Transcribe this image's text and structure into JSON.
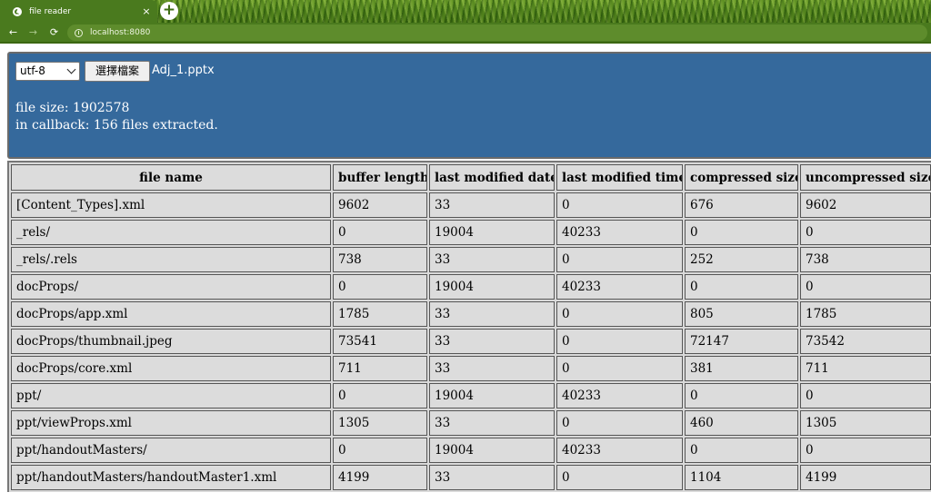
{
  "browser": {
    "tab_title": "file reader",
    "tab_close": "×",
    "new_tab": "+",
    "back": "←",
    "forward": "→",
    "reload": "⟳",
    "url": "localhost:8080"
  },
  "controls": {
    "encoding": "utf-8",
    "file_button": "選擇檔案",
    "file_name": "Adj_1.pptx"
  },
  "info": {
    "file_size": "file size: 1902578",
    "callback": "in callback: 156 files extracted."
  },
  "table": {
    "headers": [
      "file name",
      "buffer length",
      "last modified date",
      "last modified time",
      "compressed size",
      "uncompressed size"
    ],
    "rows": [
      [
        "[Content_Types].xml",
        "9602",
        "33",
        "0",
        "676",
        "9602"
      ],
      [
        "_rels/",
        "0",
        "19004",
        "40233",
        "0",
        "0"
      ],
      [
        "_rels/.rels",
        "738",
        "33",
        "0",
        "252",
        "738"
      ],
      [
        "docProps/",
        "0",
        "19004",
        "40233",
        "0",
        "0"
      ],
      [
        "docProps/app.xml",
        "1785",
        "33",
        "0",
        "805",
        "1785"
      ],
      [
        "docProps/thumbnail.jpeg",
        "73541",
        "33",
        "0",
        "72147",
        "73542"
      ],
      [
        "docProps/core.xml",
        "711",
        "33",
        "0",
        "381",
        "711"
      ],
      [
        "ppt/",
        "0",
        "19004",
        "40233",
        "0",
        "0"
      ],
      [
        "ppt/viewProps.xml",
        "1305",
        "33",
        "0",
        "460",
        "1305"
      ],
      [
        "ppt/handoutMasters/",
        "0",
        "19004",
        "40233",
        "0",
        "0"
      ],
      [
        "ppt/handoutMasters/handoutMaster1.xml",
        "4199",
        "33",
        "0",
        "1104",
        "4199"
      ]
    ]
  }
}
